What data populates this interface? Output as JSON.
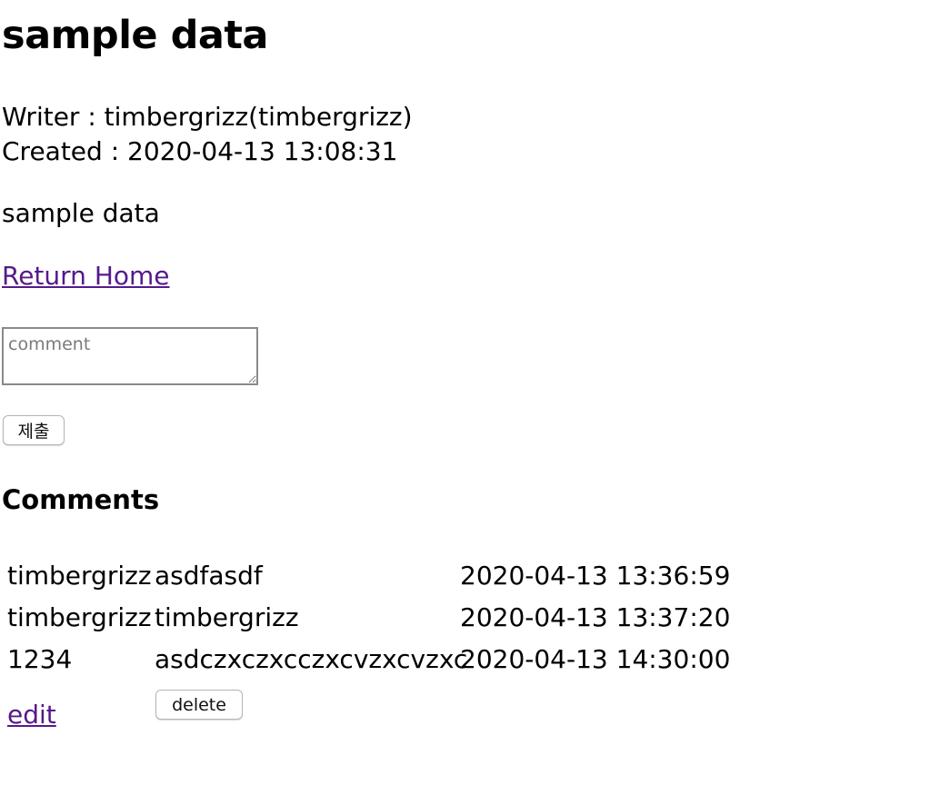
{
  "post": {
    "title": "sample data",
    "writer_line": "Writer : timbergrizz(timbergrizz)",
    "created_line": "Created : 2020-04-13 13:08:31",
    "body": "sample data"
  },
  "nav": {
    "return_home": "Return Home"
  },
  "comment_form": {
    "placeholder": "comment",
    "value": "",
    "submit_label": "제출"
  },
  "comments": {
    "heading": "Comments",
    "rows": [
      {
        "writer": "timbergrizz",
        "text": "asdfasdf",
        "date": "2020-04-13 13:36:59"
      },
      {
        "writer": "timbergrizz",
        "text": "timbergrizz",
        "date": "2020-04-13 13:37:20"
      },
      {
        "writer": "1234",
        "text": "asdczxczxcczxcvzxcvzxc",
        "date": "2020-04-13 14:30:00"
      }
    ],
    "edit_label": "edit",
    "delete_label": "delete"
  },
  "colors": {
    "link": "#551a8b",
    "text": "#000000",
    "background": "#ffffff"
  }
}
